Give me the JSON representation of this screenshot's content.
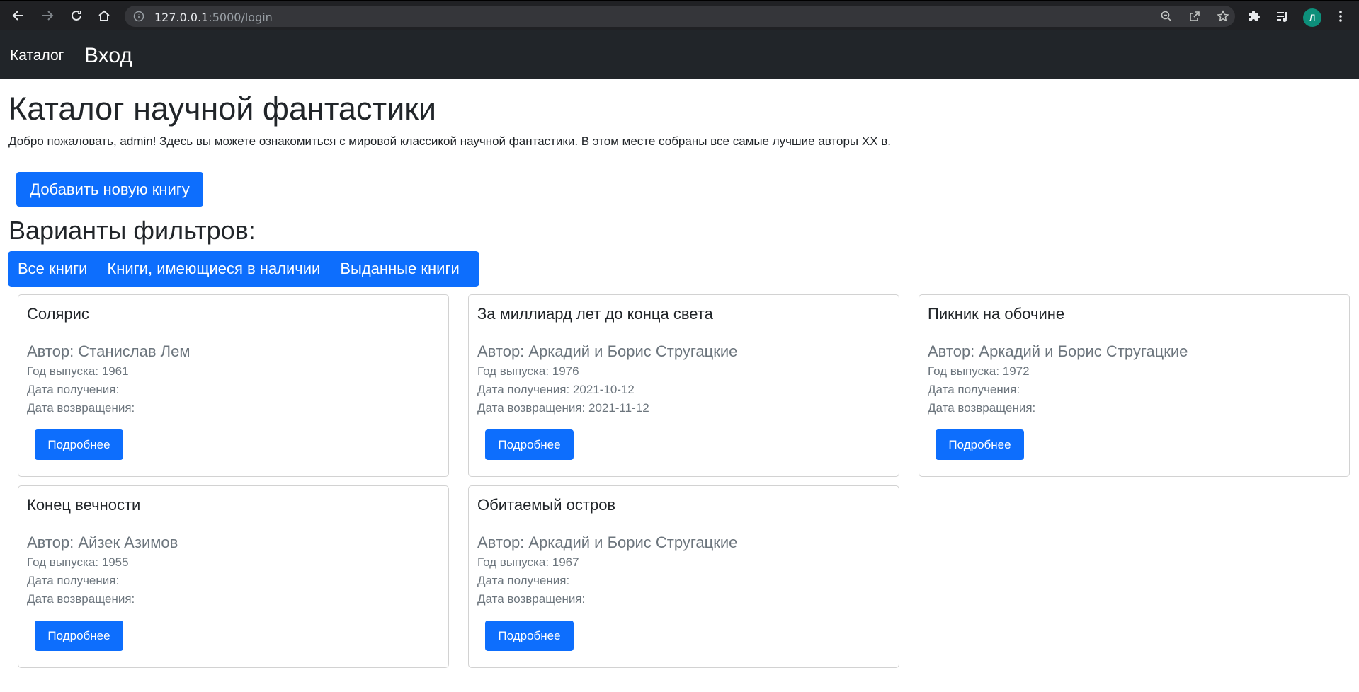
{
  "browser": {
    "url_host": "127.0.0.1",
    "url_path": ":5000/login",
    "profile_initial": "Л"
  },
  "navbar": {
    "brand": "Каталог",
    "login": "Вход"
  },
  "main": {
    "title": "Каталог научной фантастики",
    "welcome": "Добро пожаловать, admin! Здесь вы можете ознакомиться с мировой классикой научной фантастики. В этом месте собраны все самые лучшие авторы XX в.",
    "add_book_label": "Добавить новую книгу",
    "filters_title": "Варианты фильтров:",
    "filters": [
      "Все книги",
      "Книги, имеющиеся в наличии",
      "Выданные книги"
    ]
  },
  "books": [
    {
      "title": "Солярис",
      "author": "Автор: Станислав Лем",
      "year": "Год выпуска: 1961",
      "received": "Дата получения:",
      "returned": "Дата возвращения:",
      "button": "Подробнее"
    },
    {
      "title": "За миллиард лет до конца света",
      "author": "Автор: Аркадий и Борис Стругацкие",
      "year": "Год выпуска: 1976",
      "received": "Дата получения: 2021-10-12",
      "returned": "Дата возвращения: 2021-11-12",
      "button": "Подробнее"
    },
    {
      "title": "Пикник на обочине",
      "author": "Автор: Аркадий и Борис Стругацкие",
      "year": "Год выпуска: 1972",
      "received": "Дата получения:",
      "returned": "Дата возвращения:",
      "button": "Подробнее"
    },
    {
      "title": "Конец вечности",
      "author": "Автор: Айзек Азимов",
      "year": "Год выпуска: 1955",
      "received": "Дата получения:",
      "returned": "Дата возвращения:",
      "button": "Подробнее"
    },
    {
      "title": "Обитаемый остров",
      "author": "Автор: Аркадий и Борис Стругацкие",
      "year": "Год выпуска: 1967",
      "received": "Дата получения:",
      "returned": "Дата возвращения:",
      "button": "Подробнее"
    }
  ],
  "colors": {
    "primary": "#0d6efd",
    "navbar": "#212529",
    "muted": "#6c757d"
  }
}
